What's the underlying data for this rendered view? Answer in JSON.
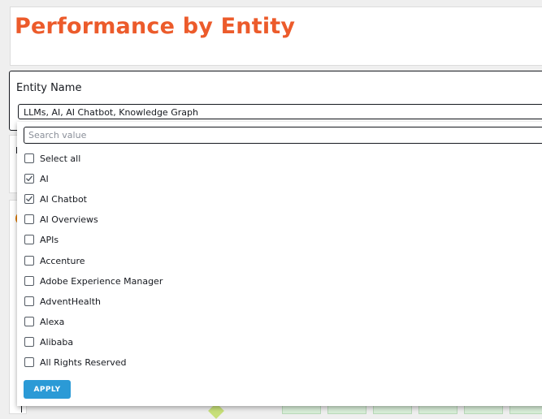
{
  "header": {
    "title": "Performance by Entity"
  },
  "filter": {
    "label": "Entity Name",
    "selected_value": "LLMs, AI, AI Chatbot, Knowledge Graph"
  },
  "dropdown": {
    "search_placeholder": "Search value",
    "options": [
      {
        "label": "Select all",
        "checked": false
      },
      {
        "label": "AI",
        "checked": true
      },
      {
        "label": "AI Chatbot",
        "checked": true
      },
      {
        "label": "AI Overviews",
        "checked": false
      },
      {
        "label": "APIs",
        "checked": false
      },
      {
        "label": "Accenture",
        "checked": false
      },
      {
        "label": "Adobe Experience Manager",
        "checked": false
      },
      {
        "label": "AdventHealth",
        "checked": false
      },
      {
        "label": "Alexa",
        "checked": false
      },
      {
        "label": "Alibaba",
        "checked": false
      },
      {
        "label": "All Rights Reserved",
        "checked": false
      }
    ],
    "apply_label": "APPLY"
  },
  "colors": {
    "title": "#ec5b2b",
    "apply_button": "#2b9ad6",
    "checkmark": "#545b64"
  },
  "icons": {
    "checked": "checkmark-icon"
  }
}
